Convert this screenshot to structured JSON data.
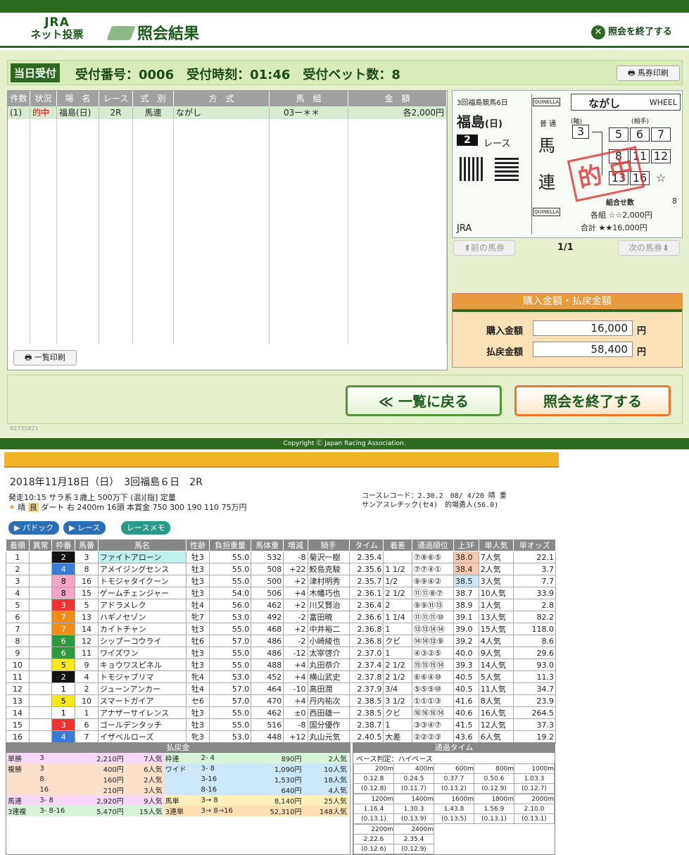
{
  "header": {
    "logo_top": "JRA",
    "logo_bottom": "ネット投票",
    "title": "照会結果",
    "end_label": "照会を終了する"
  },
  "receipt": {
    "label": "当日受付",
    "text": "受付番号：0006　受付時刻：01:46　受付ベット数：8",
    "print": "馬券印刷"
  },
  "bet_table": {
    "headers": [
      "件数",
      "状況",
      "場　名",
      "レース",
      "式　別",
      "方　式",
      "馬　組",
      "金　額"
    ],
    "row": [
      "(1)",
      "的中",
      "福島(日)",
      "2R",
      "馬連",
      "ながし",
      "03ー＊＊",
      "各2,000円"
    ],
    "list_print": "一覧印刷"
  },
  "ticket": {
    "meet": "3回福島競馬6日",
    "venue": "福島",
    "venue_day": "(日)",
    "race_no": "2",
    "race_label": "レース",
    "quinella": "QUINELLA",
    "method": "ながし",
    "wheel": "WHEEL",
    "axis_label": "(軸)",
    "partner_label": "(相手)",
    "type_small": "普 通",
    "type1": "馬",
    "type2": "連",
    "axis": "3",
    "partners": [
      "5",
      "6",
      "7",
      "8",
      "11",
      "12",
      "13",
      "16",
      "☆"
    ],
    "stamp": "的 中",
    "combos_label": "組合せ数",
    "combos": "8",
    "each": "各組 ☆☆2,000円",
    "total": "合計 ★★16,000円",
    "jra": "JRA"
  },
  "nav": {
    "prev": "前の馬券",
    "page": "1/1",
    "next": "次の馬券"
  },
  "amounts": {
    "title": "購入金額・払戻金額",
    "buy_label": "購入金額",
    "buy": "16,000",
    "ref_label": "払戻金額",
    "ref": "58,400",
    "yen": "円"
  },
  "buttons": {
    "back": "≪ 一覧に戻る",
    "end": "照会を終了する"
  },
  "small_id": "82735821",
  "copyright": "Copyright Ⓒ Japan Racing Association.",
  "race": {
    "date": "2018年11月18日（日）　3回福島６日　2R",
    "line1": "発走10:15 サラ系３歳上 500万下 (混)[指] 定量",
    "weather": "晴",
    "going": "良",
    "line2": "ダート 右 2400m 16頭 本賞金 750 300 190 110 75万円",
    "record1": "コースレコード：2.30.2　08/ 4/20 晴 重",
    "record2": "サンアスレチック(セ4)　的場勇人(56.0)",
    "tabs": [
      "パドック",
      "レース",
      "レースメモ"
    ]
  },
  "results_headers": [
    "着順",
    "異常",
    "枠番",
    "馬番",
    "馬名",
    "性齢",
    "負担重量",
    "馬体重",
    "増減",
    "騎手",
    "タイム",
    "着差",
    "通過順位",
    "上3F",
    "単人気",
    "単オッズ"
  ],
  "results": [
    [
      "1",
      "",
      "2",
      "3",
      "ファイトアローン",
      "牡3",
      "55.0",
      "532",
      "-8",
      "菊沢一樹",
      "2.35.4",
      "",
      "⑦⑧⑥⑤",
      "38.0",
      "7人気",
      "22.1"
    ],
    [
      "2",
      "",
      "4",
      "8",
      "アメイジングセンス",
      "牡3",
      "55.0",
      "508",
      "+22",
      "鮫島克駿",
      "2.35.6",
      "1 1/2",
      "⑦⑦④①",
      "38.4",
      "2人気",
      "3.7"
    ],
    [
      "3",
      "",
      "8",
      "16",
      "トモジャタイクーン",
      "牡3",
      "55.0",
      "500",
      "+2",
      "津村明秀",
      "2.35.7",
      "1/2",
      "⑨⑨④②",
      "38.5",
      "3人気",
      "7.7"
    ],
    [
      "4",
      "",
      "8",
      "15",
      "ゲームチェンジャー",
      "牡3",
      "54.0",
      "506",
      "+4",
      "木幡巧也",
      "2.36.1",
      "2 1/2",
      "⑪⑪⑧⑦",
      "38.7",
      "10人気",
      "33.9"
    ],
    [
      "5",
      "",
      "3",
      "5",
      "アドラメレク",
      "牡4",
      "56.0",
      "462",
      "+2",
      "川又賢治",
      "2.36.4",
      "2",
      "⑨⑨⑪⑬",
      "38.9",
      "1人気",
      "2.8"
    ],
    [
      "6",
      "",
      "7",
      "13",
      "ハギノセゾン",
      "牝7",
      "53.0",
      "492",
      "-2",
      "富田暁",
      "2.36.6",
      "1 1/4",
      "⑪⑪⑪⑩",
      "39.1",
      "13人気",
      "82.2"
    ],
    [
      "7",
      "",
      "7",
      "14",
      "カイトチャン",
      "牡3",
      "55.0",
      "468",
      "+2",
      "中井裕二",
      "2.36.8",
      "1",
      "⑬⑬⑭⑭",
      "39.0",
      "15人気",
      "118.0"
    ],
    [
      "8",
      "",
      "6",
      "12",
      "シップーコウライ",
      "牡6",
      "57.0",
      "486",
      "-2",
      "小崎綾也",
      "2.36.8",
      "クビ",
      "⑭⑭⑬⑨",
      "39.2",
      "4人気",
      "8.6"
    ],
    [
      "9",
      "",
      "6",
      "11",
      "ワイズワン",
      "牡3",
      "55.0",
      "486",
      "-12",
      "太宰啓介",
      "2.37.0",
      "1",
      "④③②⑤",
      "40.0",
      "9人気",
      "29.6"
    ],
    [
      "10",
      "",
      "5",
      "9",
      "キョウワスピネル",
      "牡3",
      "55.0",
      "488",
      "+4",
      "丸田恭介",
      "2.37.4",
      "2 1/2",
      "⑮⑮⑮⑭",
      "39.3",
      "14人気",
      "93.0"
    ],
    [
      "11",
      "",
      "2",
      "4",
      "トモジャプリマ",
      "牝4",
      "53.0",
      "452",
      "+4",
      "横山武史",
      "2.37.8",
      "2 1/2",
      "⑥⑥④⑩",
      "40.5",
      "5人気",
      "11.3"
    ],
    [
      "12",
      "",
      "1",
      "2",
      "ジューンアンカー",
      "牡4",
      "57.0",
      "464",
      "-10",
      "高田潤",
      "2.37.9",
      "3/4",
      "⑤⑤⑤⑩",
      "40.5",
      "11人気",
      "34.7"
    ],
    [
      "13",
      "",
      "5",
      "10",
      "スマートガイア",
      "セ6",
      "57.0",
      "470",
      "+4",
      "丹内祐次",
      "2.38.5",
      "3 1/2",
      "①①①③",
      "41.6",
      "8人気",
      "23.9"
    ],
    [
      "14",
      "",
      "1",
      "1",
      "アナザーサイレンス",
      "牡3",
      "55.0",
      "462",
      "±0",
      "西田雄一",
      "2.38.5",
      "クビ",
      "⑯⑯⑯⑭",
      "40.6",
      "16人気",
      "264.5"
    ],
    [
      "15",
      "",
      "3",
      "6",
      "ゴールデンタッチ",
      "牡3",
      "55.0",
      "516",
      "-8",
      "国分優作",
      "2.38.7",
      "1",
      "③③④⑦",
      "41.5",
      "12人気",
      "37.3"
    ],
    [
      "16",
      "",
      "4",
      "7",
      "イザベルローズ",
      "牝3",
      "53.0",
      "448",
      "+12",
      "丸山元気",
      "2.40.5",
      "大差",
      "②②②③",
      "43.6",
      "6人気",
      "19.2"
    ]
  ],
  "payout": {
    "title": "払戻金",
    "rows": [
      [
        "単勝",
        "3",
        "2,210円",
        "7人気",
        "枠連",
        "2- 4",
        "890円",
        "2人気"
      ],
      [
        "複勝",
        "3",
        "400円",
        "6人気",
        "ワイド",
        "3- 8",
        "1,090円",
        "10人気"
      ],
      [
        "",
        "8",
        "160円",
        "2人気",
        "",
        "3-16",
        "1,530円",
        "18人気"
      ],
      [
        "",
        "16",
        "210円",
        "3人気",
        "",
        "8-16",
        "640円",
        "4人気"
      ],
      [
        "馬連",
        "3- 8",
        "2,920円",
        "9人気",
        "馬単",
        "3→ 8",
        "8,140円",
        "25人気"
      ],
      [
        "3連複",
        "3- 8-16",
        "5,470円",
        "15人気",
        "3連単",
        "3→ 8→16",
        "52,310円",
        "148人気"
      ]
    ]
  },
  "passing": {
    "title": "通過タイム",
    "pace": "ペース判定：ハイペース",
    "blocks": [
      {
        "dist": [
          "200m",
          "400m",
          "600m",
          "800m",
          "1000m"
        ],
        "t": [
          "0.12.8",
          "0.24.5",
          "0.37.7",
          "0.50.6",
          "1.03.3"
        ],
        "s": [
          "(0.12.8)",
          "(0.11.7)",
          "(0.13.2)",
          "(0.12.9)",
          "(0.12.7)"
        ]
      },
      {
        "dist": [
          "1200m",
          "1400m",
          "1600m",
          "1800m",
          "2000m"
        ],
        "t": [
          "1.16.4",
          "1.30.3",
          "1.43.8",
          "1.56.9",
          "2.10.0"
        ],
        "s": [
          "(0.13.1)",
          "(0.13.9)",
          "(0.13.5)",
          "(0.13.1)",
          "(0.13.1)"
        ]
      },
      {
        "dist": [
          "2200m",
          "2400m"
        ],
        "t": [
          "2.22.6",
          "2.35.4"
        ],
        "s": [
          "(0.12.6)",
          "(0.12.9)"
        ]
      }
    ]
  },
  "colors": {
    "green": "#2d6a1f",
    "orange": "#e89a3e"
  }
}
